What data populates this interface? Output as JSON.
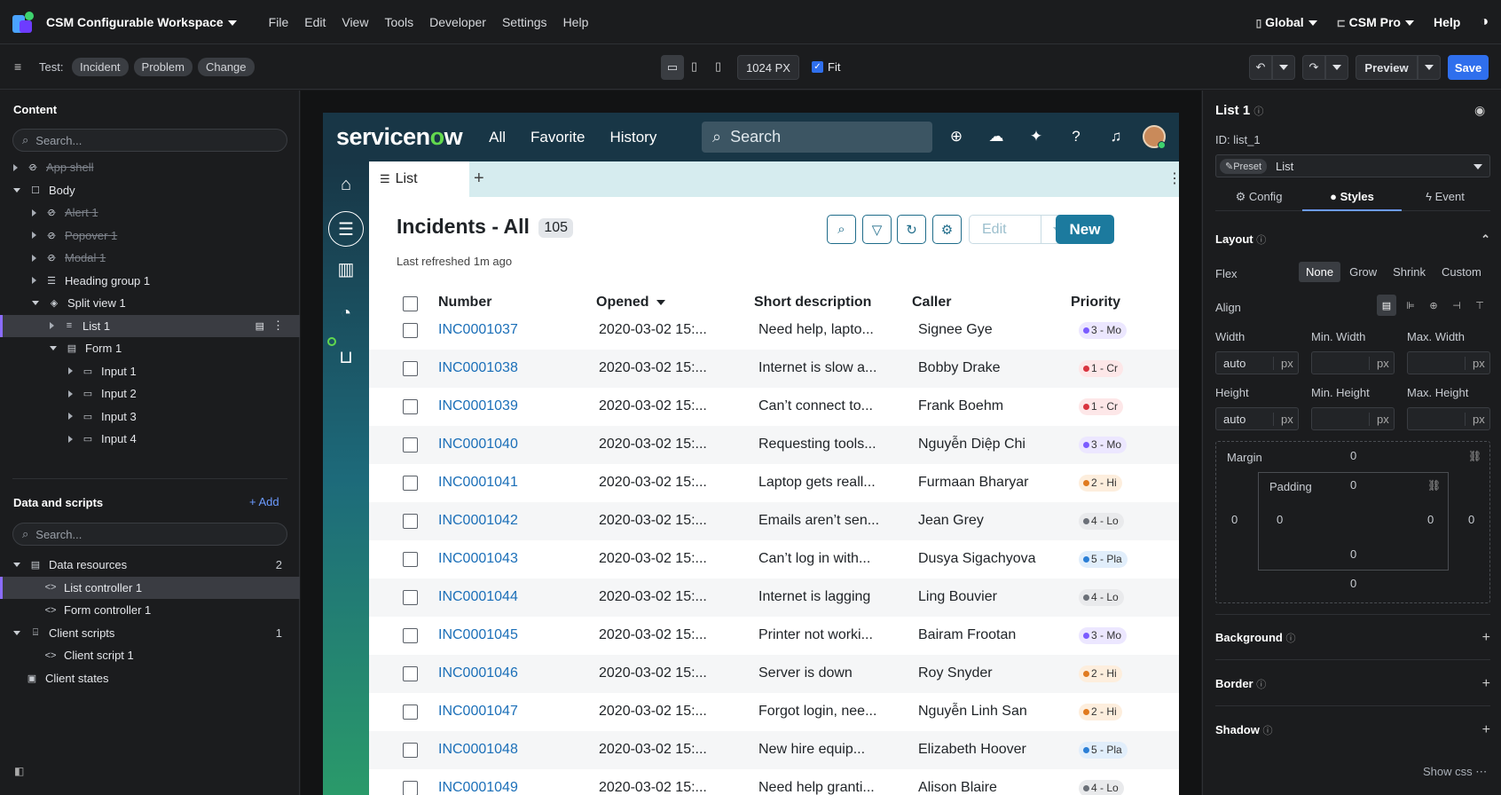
{
  "menubar": {
    "workspace": "CSM Configurable Workspace",
    "menus": [
      "File",
      "Edit",
      "View",
      "Tools",
      "Developer",
      "Settings",
      "Help"
    ],
    "scope": "Global",
    "plugin": "CSM Pro",
    "help": "Help"
  },
  "toolbar": {
    "test_label": "Test:",
    "chips": [
      "Incident",
      "Problem",
      "Change"
    ],
    "width_value": "1024 PX",
    "fit_label": "Fit",
    "preview_label": "Preview",
    "save_label": "Save"
  },
  "content_panel": {
    "title": "Content",
    "search_placeholder": "Search...",
    "tree": [
      {
        "label": "App shell",
        "hidden": true
      },
      {
        "label": "Body"
      },
      {
        "label": "Alert 1",
        "hidden": true
      },
      {
        "label": "Popover 1",
        "hidden": true
      },
      {
        "label": "Modal 1",
        "hidden": true
      },
      {
        "label": "Heading group 1"
      },
      {
        "label": "Split view 1"
      },
      {
        "label": "List 1",
        "selected": true
      },
      {
        "label": "Form 1"
      },
      {
        "label": "Input 1"
      },
      {
        "label": "Input 2"
      },
      {
        "label": "Input 3"
      },
      {
        "label": "Input 4"
      }
    ]
  },
  "data_panel": {
    "title": "Data and scripts",
    "add_label": "Add",
    "search_placeholder": "Search...",
    "items": [
      {
        "label": "Data resources",
        "count": "2"
      },
      {
        "label": "List controller 1"
      },
      {
        "label": "Form controller 1"
      },
      {
        "label": "Client scripts",
        "count": "1"
      },
      {
        "label": "Client script 1"
      },
      {
        "label": "Client states"
      }
    ]
  },
  "app": {
    "logo_pre": "servicen",
    "logo_o": "o",
    "logo_post": "w",
    "nav": [
      "All",
      "Favorite",
      "History"
    ],
    "search_placeholder": "Search",
    "tab_label": "List",
    "list_title": "Incidents - All",
    "count": "105",
    "refreshed": "Last refreshed 1m ago",
    "edit_label": "Edit",
    "new_label": "New",
    "columns": [
      "Number",
      "Opened",
      "Short description",
      "Caller",
      "Priority"
    ],
    "rows": [
      {
        "number": "INC0001037",
        "opened": "2020-03-02 15:...",
        "desc": "Need help, lapto...",
        "caller": "Signee Gye",
        "priority": "3 - Mo",
        "dot": "#7b5cff",
        "bg": "#ece7ff"
      },
      {
        "number": "INC0001038",
        "opened": "2020-03-02 15:...",
        "desc": "Internet is slow a...",
        "caller": "Bobby Drake",
        "priority": "1 - Cr",
        "dot": "#d9343f",
        "bg": "#fde7e8"
      },
      {
        "number": "INC0001039",
        "opened": "2020-03-02 15:...",
        "desc": "Can’t connect to...",
        "caller": "Frank Boehm",
        "priority": "1 - Cr",
        "dot": "#d9343f",
        "bg": "#fde7e8"
      },
      {
        "number": "INC0001040",
        "opened": "2020-03-02 15:...",
        "desc": "Requesting tools...",
        "caller": "Nguyễn Diệp Chi",
        "priority": "3 - Mo",
        "dot": "#7b5cff",
        "bg": "#ece7ff"
      },
      {
        "number": "INC0001041",
        "opened": "2020-03-02 15:...",
        "desc": "Laptop gets reall...",
        "caller": "Furmaan Bharyar",
        "priority": "2 - Hi",
        "dot": "#e07a1f",
        "bg": "#fdeedd"
      },
      {
        "number": "INC0001042",
        "opened": "2020-03-02 15:...",
        "desc": "Emails aren’t sen...",
        "caller": "Jean Grey",
        "priority": "4 - Lo",
        "dot": "#6b7078",
        "bg": "#e9eaec"
      },
      {
        "number": "INC0001043",
        "opened": "2020-03-02 15:...",
        "desc": "Can’t log in with...",
        "caller": "Dusya Sigachyova",
        "priority": "5 - Pla",
        "dot": "#2b7fd6",
        "bg": "#e1eefb"
      },
      {
        "number": "INC0001044",
        "opened": "2020-03-02 15:...",
        "desc": "Internet is lagging",
        "caller": "Ling Bouvier",
        "priority": "4 - Lo",
        "dot": "#6b7078",
        "bg": "#e9eaec"
      },
      {
        "number": "INC0001045",
        "opened": "2020-03-02 15:...",
        "desc": "Printer not worki...",
        "caller": "Bairam Frootan",
        "priority": "3 - Mo",
        "dot": "#7b5cff",
        "bg": "#ece7ff"
      },
      {
        "number": "INC0001046",
        "opened": "2020-03-02 15:...",
        "desc": "Server is down",
        "caller": "Roy Snyder",
        "priority": "2 - Hi",
        "dot": "#e07a1f",
        "bg": "#fdeedd"
      },
      {
        "number": "INC0001047",
        "opened": "2020-03-02 15:...",
        "desc": "Forgot login, nee...",
        "caller": "Nguyễn Linh San",
        "priority": "2 - Hi",
        "dot": "#e07a1f",
        "bg": "#fdeedd"
      },
      {
        "number": "INC0001048",
        "opened": "2020-03-02 15:...",
        "desc": "New hire equip...",
        "caller": "Elizabeth Hoover",
        "priority": "5 - Pla",
        "dot": "#2b7fd6",
        "bg": "#e1eefb"
      },
      {
        "number": "INC0001049",
        "opened": "2020-03-02 15:...",
        "desc": "Need help granti...",
        "caller": "Alison Blaire",
        "priority": "4 - Lo",
        "dot": "#6b7078",
        "bg": "#e9eaec"
      }
    ]
  },
  "props_panel": {
    "title": "List 1",
    "id_label": "ID: list_1",
    "preset_chip": "Preset",
    "preset_value": "List",
    "tabs": [
      "Config",
      "Styles",
      "Event"
    ],
    "layout": "Layout",
    "flex_label": "Flex",
    "flex_options": [
      "None",
      "Grow",
      "Shrink",
      "Custom"
    ],
    "align_label": "Align",
    "width": "Width",
    "min_width": "Min. Width",
    "max_width": "Max. Width",
    "height": "Height",
    "min_height": "Min. Height",
    "max_height": "Max. Height",
    "auto": "auto",
    "unit": "px",
    "margin": "Margin",
    "padding": "Padding",
    "zero": "0",
    "background": "Background",
    "border": "Border",
    "shadow": "Shadow",
    "show_css": "Show css"
  },
  "colors": {
    "accent": "#2f6fed",
    "sn_header": "#183646",
    "link": "#1b6fb8",
    "new_button": "#1c7a9e"
  }
}
